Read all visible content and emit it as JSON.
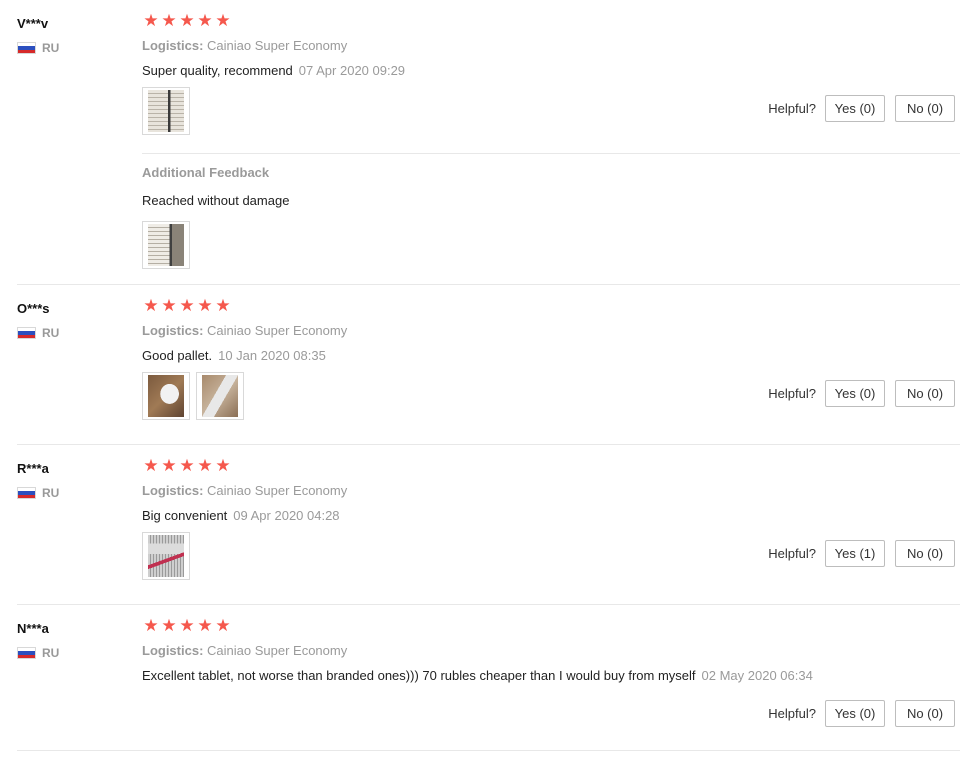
{
  "helpful_label": "Helpful?",
  "logistics_label": "Logistics:",
  "additional_feedback_label": "Additional Feedback",
  "colors": {
    "star": "#f5584d",
    "muted": "#9a9a9a",
    "flag_white": "#ffffff",
    "flag_blue": "#2b4fbf",
    "flag_red": "#d62a2a"
  },
  "reviews": [
    {
      "user": "V***v",
      "country": "RU",
      "stars": 5,
      "logistics": "Cainiao Super Economy",
      "text": "Super quality, recommend",
      "date": "07 Apr 2020 09:29",
      "yes": "Yes (0)",
      "no": "No (0)",
      "additional_feedback": "Reached without damage"
    },
    {
      "user": "O***s",
      "country": "RU",
      "stars": 5,
      "logistics": "Cainiao Super Economy",
      "text": "Good pallet.",
      "date": "10 Jan 2020 08:35",
      "yes": "Yes (0)",
      "no": "No (0)"
    },
    {
      "user": "R***a",
      "country": "RU",
      "stars": 5,
      "logistics": "Cainiao Super Economy",
      "text": "Big convenient",
      "date": "09 Apr 2020 04:28",
      "yes": "Yes (1)",
      "no": "No (0)"
    },
    {
      "user": "N***a",
      "country": "RU",
      "stars": 5,
      "logistics": "Cainiao Super Economy",
      "text": "Excellent tablet, not worse than branded ones))) 70 rubles cheaper than I would buy from myself",
      "date": "02 May 2020 06:34",
      "yes": "Yes (0)",
      "no": "No (0)"
    }
  ]
}
